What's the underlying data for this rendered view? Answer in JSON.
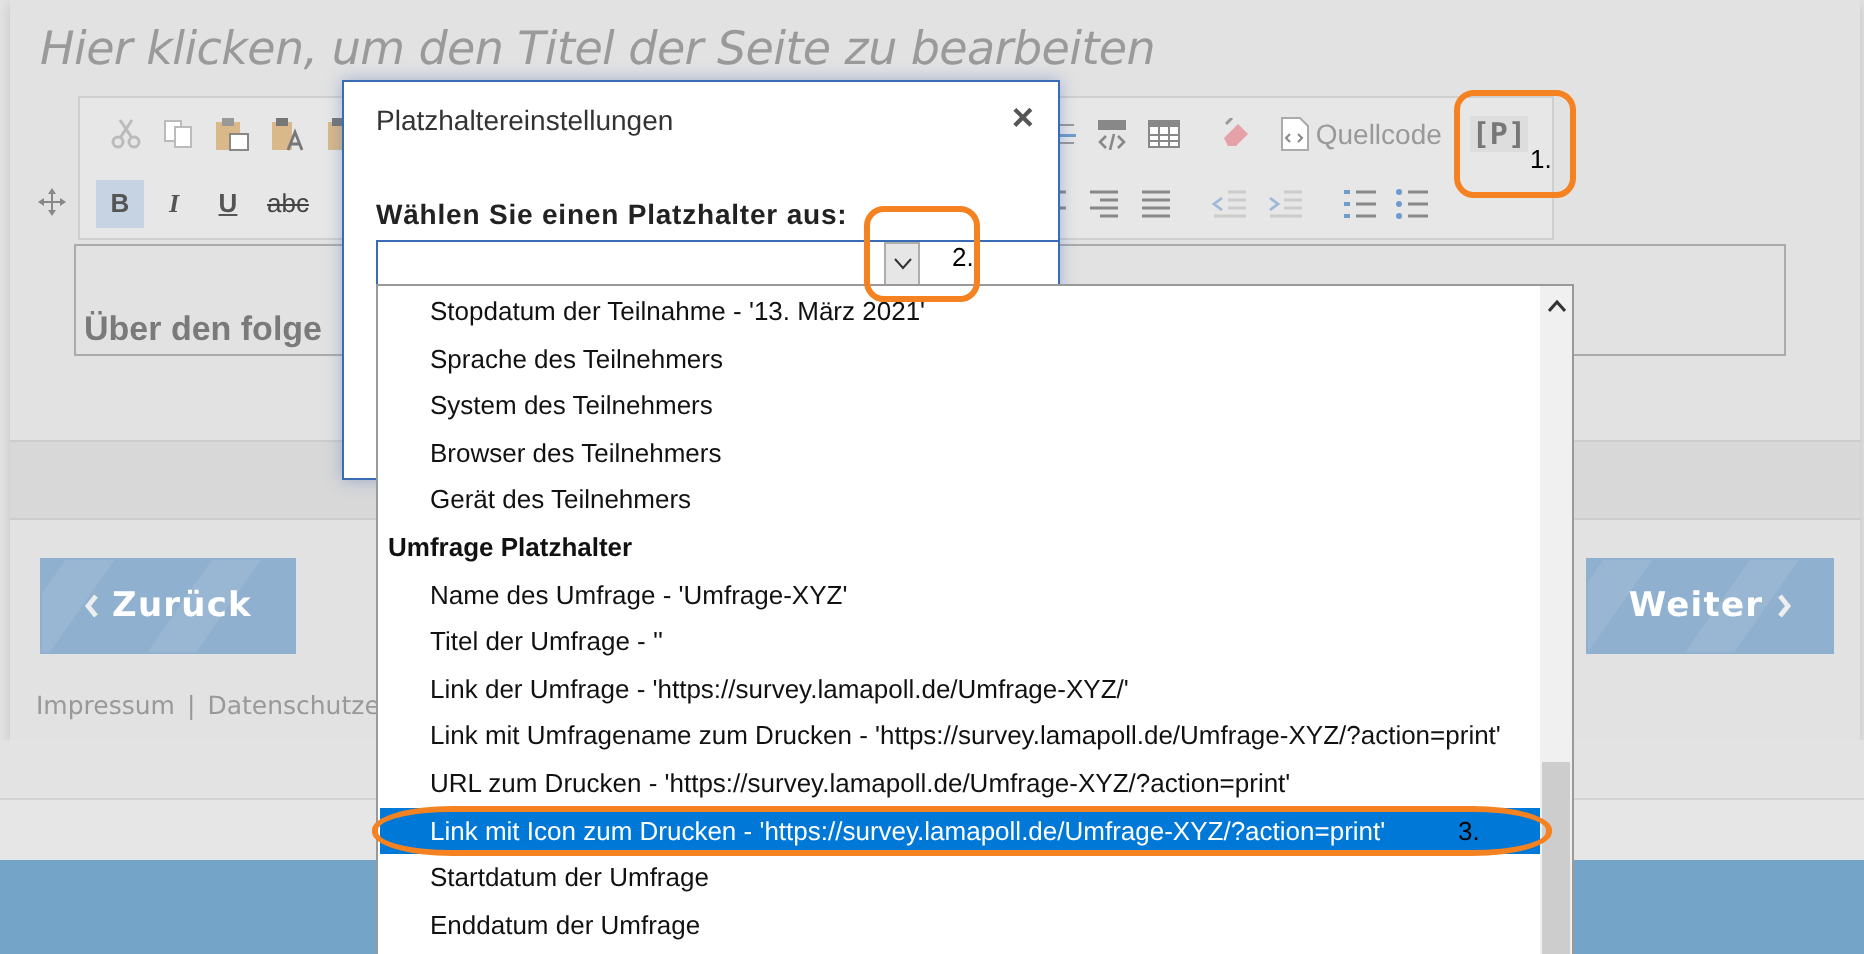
{
  "page": {
    "title_placeholder": "Hier klicken, um den Titel der Seite zu bearbeiten",
    "format_buttons": [
      {
        "label": "B",
        "kind": "bold",
        "selected": true
      },
      {
        "label": "I",
        "kind": "italic",
        "selected": false
      },
      {
        "label": "U",
        "kind": "underline",
        "selected": false
      },
      {
        "label": "abc",
        "kind": "strike",
        "selected": false
      }
    ],
    "source_label": "Quellcode",
    "placeholder_button": "[P]",
    "editor_text": "Über den folge",
    "back_button": "Zurück",
    "next_button": "Weiter",
    "footer_links": [
      "Impressum",
      "Datenschutze"
    ],
    "footer_separator": "|"
  },
  "dialog": {
    "title": "Platzhaltereinstellungen",
    "close": "×",
    "field_label": "Wählen Sie einen Platzhalter aus:",
    "options": [
      {
        "kind": "item",
        "label": "Stopdatum der Teilnahme - '13. März 2021'",
        "selected": false
      },
      {
        "kind": "item",
        "label": "Sprache des Teilnehmers",
        "selected": false
      },
      {
        "kind": "item",
        "label": "System des Teilnehmers",
        "selected": false
      },
      {
        "kind": "item",
        "label": "Browser des Teilnehmers",
        "selected": false
      },
      {
        "kind": "item",
        "label": "Gerät des Teilnehmers",
        "selected": false
      },
      {
        "kind": "group",
        "label": "Umfrage Platzhalter"
      },
      {
        "kind": "item",
        "label": "Name des Umfrage - 'Umfrage-XYZ'",
        "selected": false
      },
      {
        "kind": "item",
        "label": "Titel der Umfrage - ''",
        "selected": false
      },
      {
        "kind": "item",
        "label": "Link der Umfrage - 'https://survey.lamapoll.de/Umfrage-XYZ/'",
        "selected": false
      },
      {
        "kind": "item",
        "label": "Link mit Umfragename zum Drucken - 'https://survey.lamapoll.de/Umfrage-XYZ/?action=print'",
        "selected": false
      },
      {
        "kind": "item",
        "label": "URL zum Drucken - 'https://survey.lamapoll.de/Umfrage-XYZ/?action=print'",
        "selected": false
      },
      {
        "kind": "item",
        "label": "Link mit Icon zum Drucken - 'https://survey.lamapoll.de/Umfrage-XYZ/?action=print'",
        "selected": true
      },
      {
        "kind": "item",
        "label": "Startdatum der Umfrage",
        "selected": false
      },
      {
        "kind": "item",
        "label": "Enddatum der Umfrage",
        "selected": false
      }
    ]
  },
  "annotations": [
    {
      "kind": "box",
      "label": "1."
    },
    {
      "kind": "box",
      "label": "2."
    },
    {
      "kind": "ellipse",
      "label": "3."
    }
  ]
}
